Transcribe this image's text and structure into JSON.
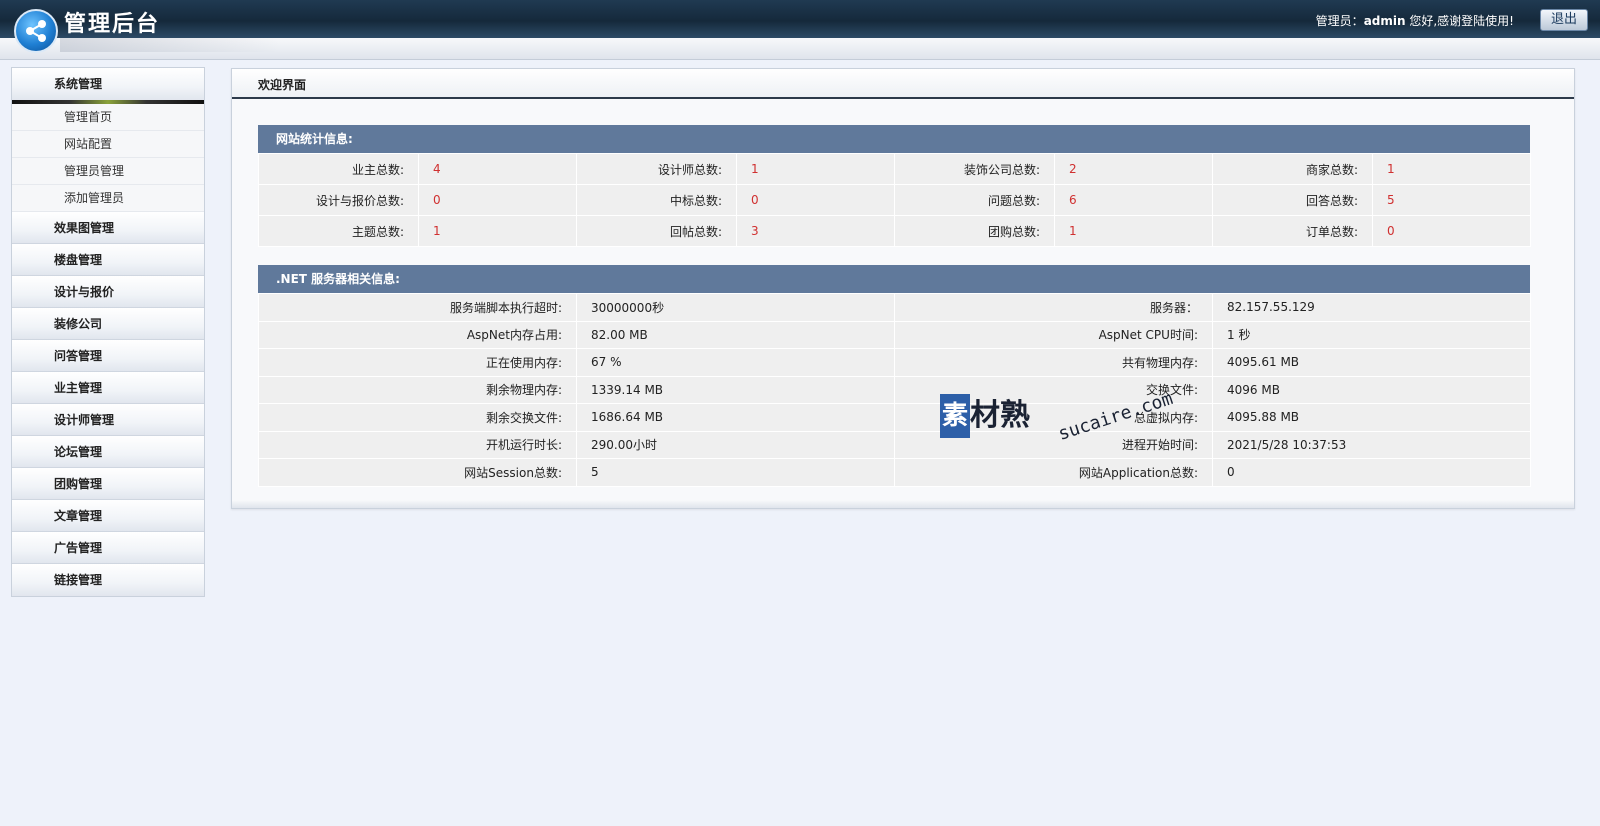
{
  "header": {
    "title": "管理后台",
    "greet_prefix": "管理员：",
    "username": "admin",
    "greet_suffix": " 您好,感谢登陆使用!",
    "logout_label": "退出"
  },
  "sidebar": {
    "groups": [
      {
        "label": "系统管理",
        "subitems": [
          "管理首页",
          "网站配置",
          "管理员管理",
          "添加管理员"
        ]
      },
      {
        "label": "效果图管理"
      },
      {
        "label": "楼盘管理"
      },
      {
        "label": "设计与报价"
      },
      {
        "label": "装修公司"
      },
      {
        "label": "问答管理"
      },
      {
        "label": "业主管理"
      },
      {
        "label": "设计师管理"
      },
      {
        "label": "论坛管理"
      },
      {
        "label": "团购管理"
      },
      {
        "label": "文章管理"
      },
      {
        "label": "广告管理"
      },
      {
        "label": "链接管理"
      }
    ]
  },
  "main": {
    "title": "欢迎界面",
    "stats": {
      "heading": "网站统计信息:",
      "rows": [
        [
          [
            "业主总数:",
            "4"
          ],
          [
            "设计师总数:",
            "1"
          ],
          [
            "装饰公司总数:",
            "2"
          ],
          [
            "商家总数:",
            "1"
          ]
        ],
        [
          [
            "设计与报价总数:",
            "0"
          ],
          [
            "中标总数:",
            "0"
          ],
          [
            "问题总数:",
            "6"
          ],
          [
            "回答总数:",
            "5"
          ]
        ],
        [
          [
            "主题总数:",
            "1"
          ],
          [
            "回帖总数:",
            "3"
          ],
          [
            "团购总数:",
            "1"
          ],
          [
            "订单总数:",
            "0"
          ]
        ]
      ]
    },
    "server": {
      "heading": ".NET 服务器相关信息:",
      "rows": [
        [
          [
            "服务端脚本执行超时:",
            "30000000秒"
          ],
          [
            "服务器：",
            "82.157.55.129"
          ]
        ],
        [
          [
            "AspNet内存占用:",
            "82.00 MB"
          ],
          [
            "AspNet CPU时间:",
            "1 秒"
          ]
        ],
        [
          [
            "正在使用内存:",
            "67 %"
          ],
          [
            "共有物理内存:",
            "4095.61 MB"
          ]
        ],
        [
          [
            "剩余物理内存:",
            "1339.14 MB"
          ],
          [
            "交换文件:",
            "4096 MB"
          ]
        ],
        [
          [
            "剩余交换文件:",
            "1686.64 MB"
          ],
          [
            "总虚拟内存:",
            "4095.88 MB"
          ]
        ],
        [
          [
            "开机运行时长:",
            "290.00小时"
          ],
          [
            "进程开始时间:",
            "2021/5/28 10:37:53"
          ]
        ],
        [
          [
            "网站Session总数:",
            "5"
          ],
          [
            "网站Application总数:",
            "0"
          ]
        ]
      ]
    }
  },
  "watermark": {
    "box": "素",
    "text": "材熟",
    "domain": "sucaire.com"
  }
}
